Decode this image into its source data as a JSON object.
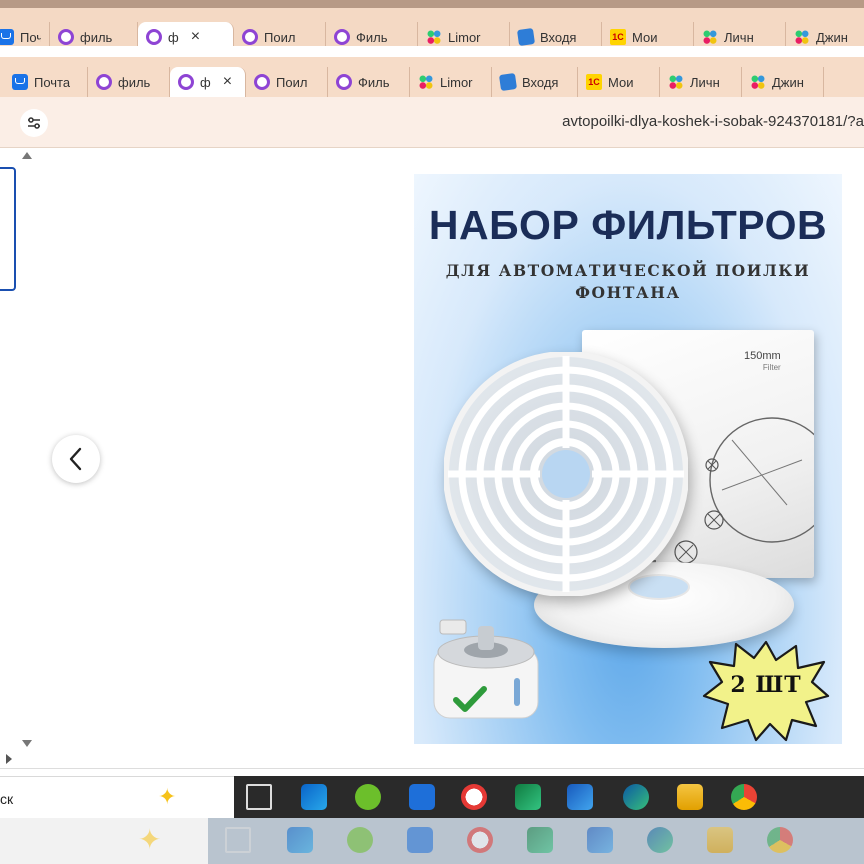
{
  "ghost_tabs": [
    {
      "label": "Почта",
      "icon": "mail-icon",
      "active": false
    },
    {
      "label": "филь",
      "icon": "ozon-ring-icon",
      "active": false
    },
    {
      "label": "ф",
      "icon": "ozon-ring-icon",
      "active": true
    },
    {
      "label": "Поил",
      "icon": "ozon-ring-icon",
      "active": false
    },
    {
      "label": "Филь",
      "icon": "ozon-ring-icon",
      "active": false
    },
    {
      "label": "Limor",
      "icon": "dots-icon",
      "active": false
    },
    {
      "label": "Входя",
      "icon": "inbox-icon",
      "active": false
    },
    {
      "label": "Мои",
      "icon": "1c-icon",
      "active": false
    },
    {
      "label": "Личн",
      "icon": "dots-icon",
      "active": false
    },
    {
      "label": "Джин",
      "icon": "dots-icon",
      "active": false
    }
  ],
  "tabs": [
    {
      "label": "Почта",
      "icon": "mail-icon",
      "active": false
    },
    {
      "label": "филь",
      "icon": "ozon-ring-icon",
      "active": false
    },
    {
      "label": "ф",
      "icon": "ozon-ring-icon",
      "active": true
    },
    {
      "label": "Поил",
      "icon": "ozon-ring-icon",
      "active": false
    },
    {
      "label": "Филь",
      "icon": "ozon-ring-icon",
      "active": false
    },
    {
      "label": "Limor",
      "icon": "dots-icon",
      "active": false
    },
    {
      "label": "Входя",
      "icon": "inbox-icon",
      "active": false
    },
    {
      "label": "Мои",
      "icon": "1c-icon",
      "active": false
    },
    {
      "label": "Личн",
      "icon": "dots-icon",
      "active": false
    },
    {
      "label": "Джин",
      "icon": "dots-icon",
      "active": false
    }
  ],
  "tab_close": "×",
  "address": {
    "url": "avtopoilki-dlya-koshek-i-sobak-924370181/?a",
    "site_settings_icon": "tune-icon"
  },
  "product": {
    "title": "НАБОР ФИЛЬТРОВ",
    "subtitle": "ДЛЯ АВТОМАТИЧЕСКОЙ ПОИЛКИ ФОНТАНА",
    "box_label": "150mm",
    "box_sublabel": "Filter",
    "badge": "2 ШТ"
  },
  "carousel": {
    "prev_icon": "chevron-left-icon"
  },
  "search": {
    "text": "ск"
  },
  "taskbar_icons": [
    "task-view-icon",
    "outlook-icon",
    "utorrent-icon",
    "download-icon",
    "yandex-browser-icon",
    "excel-icon",
    "word-icon",
    "edge-icon",
    "file-explorer-icon",
    "chrome-icon"
  ],
  "colors": {
    "tab_strip": "#f6dcc8",
    "address_bar": "#fbeee6",
    "active_tab": "#ffffff",
    "ozon_purple": "#8e44d4",
    "title_navy": "#1b2d58",
    "taskbar": "#2a2a2a"
  }
}
